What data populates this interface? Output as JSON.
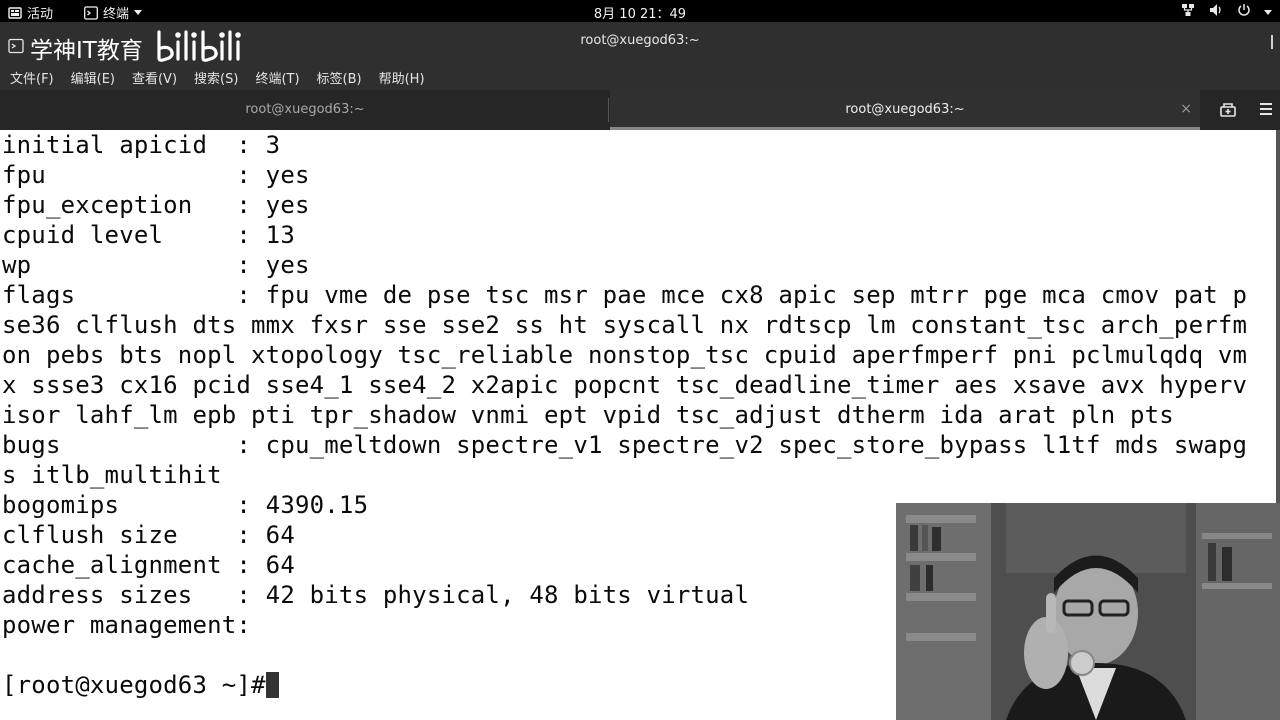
{
  "topbar": {
    "activities": "活动",
    "app_name": "终端",
    "clock": "8月 10  21：49"
  },
  "window": {
    "title": "root@xuegod63:~",
    "watermark": "学神IT教育"
  },
  "menubar": {
    "items": [
      "文件(F)",
      "编辑(E)",
      "查看(V)",
      "搜索(S)",
      "终端(T)",
      "标签(B)",
      "帮助(H)"
    ]
  },
  "tabs": [
    {
      "label": "root@xuegod63:~",
      "active": false
    },
    {
      "label": "root@xuegod63:~",
      "active": true,
      "close": "×"
    }
  ],
  "terminal": {
    "lines": [
      "initial apicid  : 3",
      "fpu             : yes",
      "fpu_exception   : yes",
      "cpuid level     : 13",
      "wp              : yes",
      "flags           : fpu vme de pse tsc msr pae mce cx8 apic sep mtrr pge mca cmov pat p",
      "se36 clflush dts mmx fxsr sse sse2 ss ht syscall nx rdtscp lm constant_tsc arch_perfm",
      "on pebs bts nopl xtopology tsc_reliable nonstop_tsc cpuid aperfmperf pni pclmulqdq vm",
      "x ssse3 cx16 pcid sse4_1 sse4_2 x2apic popcnt tsc_deadline_timer aes xsave avx hyperv",
      "isor lahf_lm epb pti tpr_shadow vnmi ept vpid tsc_adjust dtherm ida arat pln pts",
      "bugs            : cpu_meltdown spectre_v1 spectre_v2 spec_store_bypass l1tf mds swapg",
      "s itlb_multihit",
      "bogomips        : 4390.15",
      "clflush size    : 64",
      "cache_alignment : 64",
      "address sizes   : 42 bits physical, 48 bits virtual",
      "power management:",
      ""
    ],
    "prompt": "[root@xuegod63 ~]#"
  },
  "colors": {
    "topbar_bg": "#000000",
    "titlebar_bg": "#2f2f2f",
    "tabbar_bg": "#262626",
    "terminal_bg": "#ffffff",
    "terminal_fg": "#0a0a0a"
  },
  "icons": {
    "activities": "terminal-icon",
    "app_menu_arrow": "caret-down-icon",
    "tray": [
      "network-icon",
      "volume-icon",
      "power-icon"
    ],
    "new_tab": "new-tab-icon",
    "tab_menu": "hamburger-menu-icon"
  }
}
